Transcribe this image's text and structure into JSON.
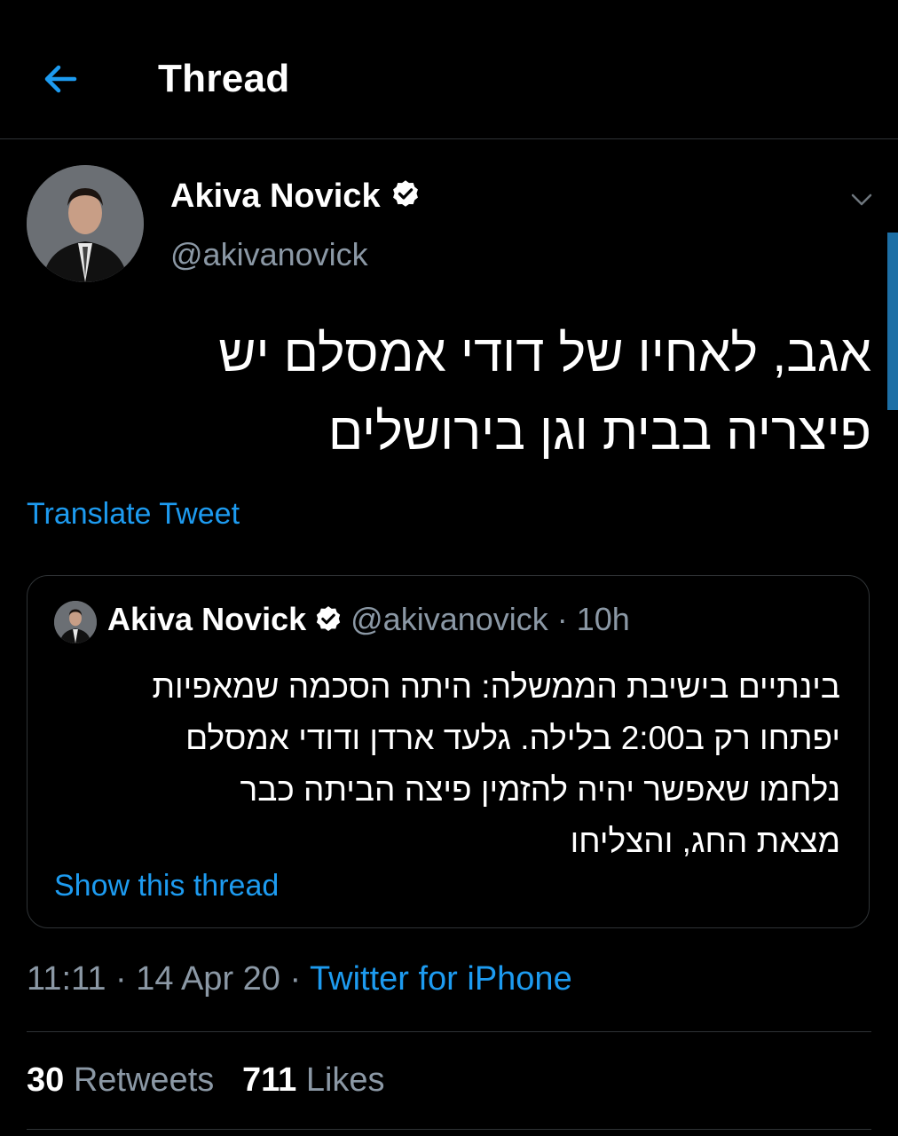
{
  "header": {
    "title": "Thread",
    "back_icon": "arrow-left-icon"
  },
  "tweet": {
    "author_name": "Akiva Novick",
    "author_handle": "@akivanovick",
    "text_lines": [
      "אגב, לאחיו של דודי אמסלם יש",
      "פיצריה בבית וגן בירושלים"
    ],
    "translate_label": "Translate Tweet",
    "time": "11:11",
    "sep1": " · ",
    "date": "14 Apr 20",
    "sep2": " · ",
    "source": "Twitter for iPhone",
    "retweets_count": "30",
    "retweets_label": "Retweets",
    "likes_count": "711",
    "likes_label": "Likes"
  },
  "quoted": {
    "author_name": "Akiva Novick",
    "handle_time": "@akivanovick · 10h",
    "text_lines": [
      "בינתיים בישיבת הממשלה: היתה הסכמה שמאפיות",
      "יפתחו רק ב2:00 בלילה. גלעד ארדן ודודי אמסלם",
      "נלחמו שאפשר יהיה להזמין פיצה הביתה כבר",
      "מצאת החג, והצליחו"
    ],
    "show_thread_label": "Show this thread"
  },
  "colors": {
    "background": "#000000",
    "accent": "#1d9bf0",
    "muted": "#8b98a5",
    "divider": "#2f3336"
  }
}
